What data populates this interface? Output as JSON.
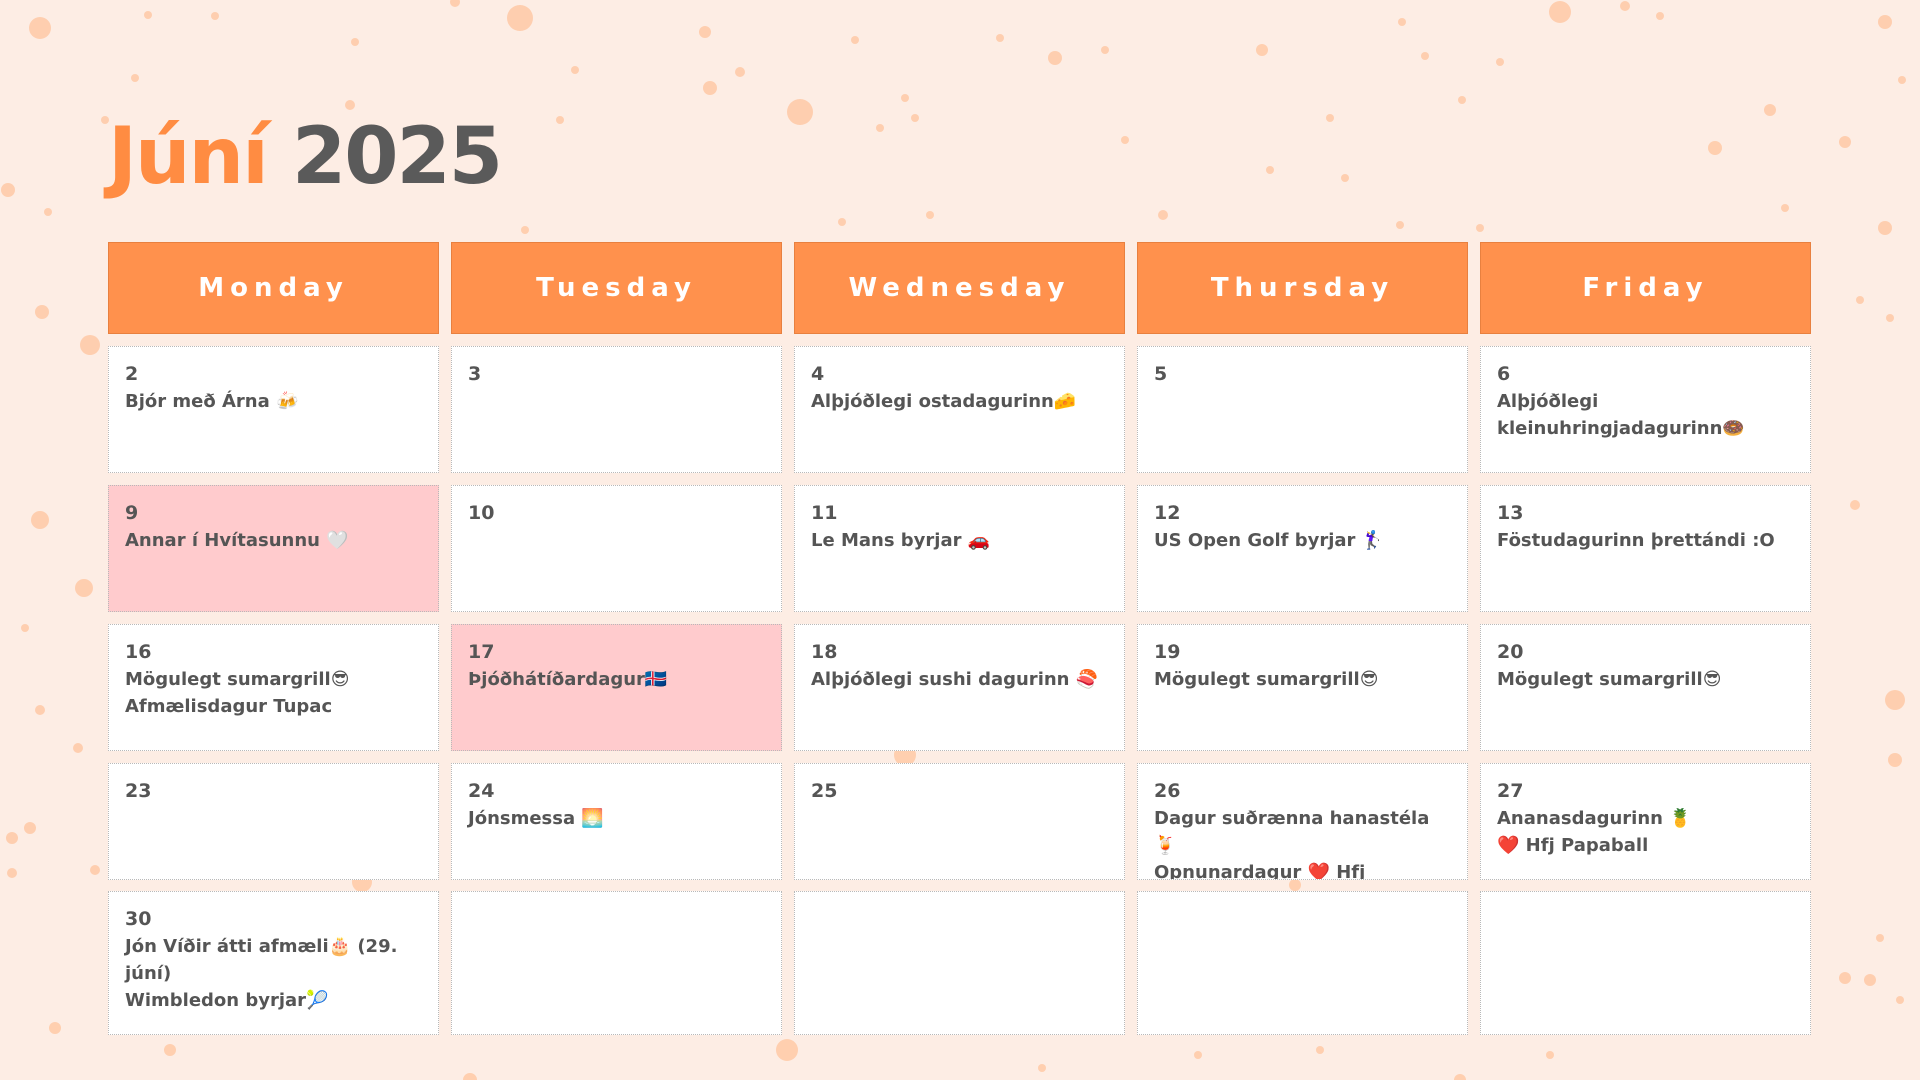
{
  "title": {
    "month": "Júní",
    "year": "2025"
  },
  "weekdays": [
    "Monday",
    "Tuesday",
    "Wednesday",
    "Thursday",
    "Friday"
  ],
  "colors": {
    "background": "#fdede4",
    "accent": "#ff914d",
    "holiday": "#ffcbcd",
    "text": "#555555"
  },
  "weeks": [
    [
      {
        "day": "2",
        "events": [
          "Bjór með Árna 🍻"
        ]
      },
      {
        "day": "3",
        "events": []
      },
      {
        "day": "4",
        "events": [
          "Alþjóðlegi ostadagurinn🧀"
        ]
      },
      {
        "day": "5",
        "events": []
      },
      {
        "day": "6",
        "events": [
          "Alþjóðlegi kleinuhringjadagurinn🍩"
        ]
      }
    ],
    [
      {
        "day": "9",
        "events": [
          "Annar í Hvítasunnu 🤍"
        ],
        "holiday": true
      },
      {
        "day": "10",
        "events": []
      },
      {
        "day": "11",
        "events": [
          "Le Mans byrjar 🚗"
        ]
      },
      {
        "day": "12",
        "events": [
          "US Open Golf byrjar 🏌️‍♀️"
        ]
      },
      {
        "day": "13",
        "events": [
          "Föstudagurinn þrettándi :O"
        ]
      }
    ],
    [
      {
        "day": "16",
        "events": [
          "Mögulegt sumargrill😎",
          "Afmælisdagur Tupac"
        ]
      },
      {
        "day": "17",
        "events": [
          "Þjóðhátíðardagur🇮🇸"
        ],
        "holiday": true
      },
      {
        "day": "18",
        "events": [
          "Alþjóðlegi sushi dagurinn 🍣"
        ]
      },
      {
        "day": "19",
        "events": [
          "Mögulegt sumargrill😎"
        ]
      },
      {
        "day": "20",
        "events": [
          "Mögulegt sumargrill😎"
        ]
      }
    ],
    [
      {
        "day": "23",
        "events": []
      },
      {
        "day": "24",
        "events": [
          "Jónsmessa 🌅"
        ]
      },
      {
        "day": "25",
        "events": []
      },
      {
        "day": "26",
        "events": [
          "Dagur suðrænna hanastéla 🍹",
          "Opnunardagur ❤️ Hfj"
        ]
      },
      {
        "day": "27",
        "events": [
          "Ananasdagurinn 🍍",
          "❤️ Hfj Papaball"
        ]
      }
    ],
    [
      {
        "day": "30",
        "events": [
          "Jón Víðir átti afmæli🎂 (29. júní)",
          "Wimbledon byrjar🎾"
        ]
      },
      {
        "day": "",
        "events": []
      },
      {
        "day": "",
        "events": []
      },
      {
        "day": "",
        "events": []
      },
      {
        "day": "",
        "events": []
      }
    ]
  ]
}
